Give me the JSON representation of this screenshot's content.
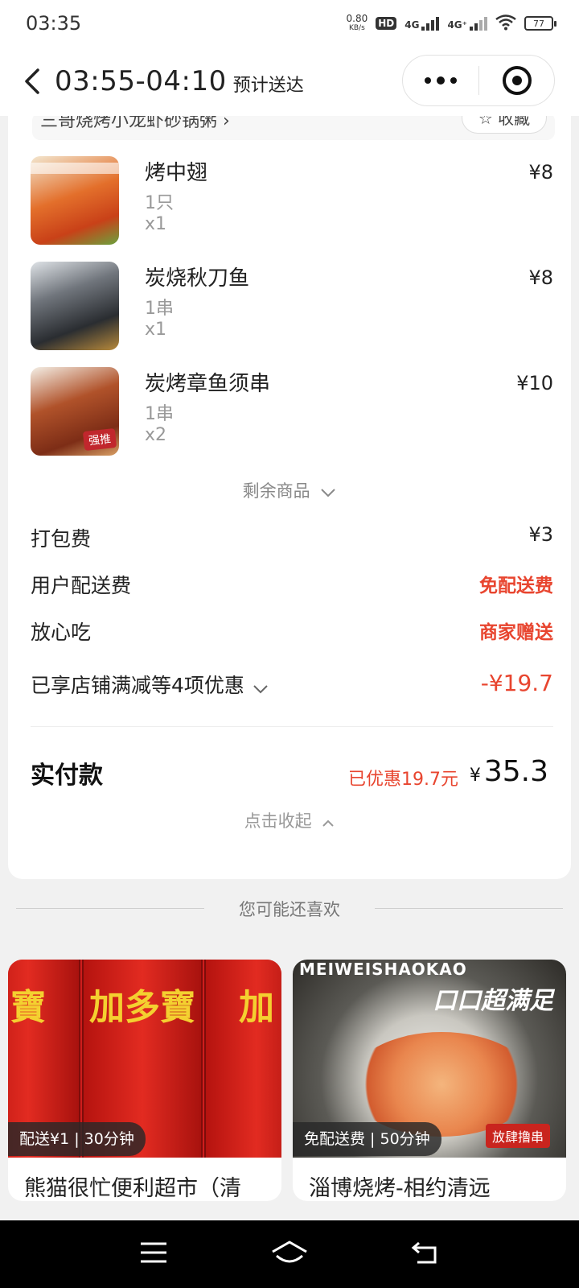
{
  "status_bar": {
    "time": "03:35",
    "net_speed_value": "0.80",
    "net_speed_unit": "KB/s",
    "hd_label": "HD",
    "sim1": "1",
    "sim2": "2",
    "net1": "4G",
    "net2": "4G⁺",
    "battery": "77"
  },
  "nav": {
    "delivery_time": "03:55-04:10",
    "delivery_label": "预计送达"
  },
  "store_row": {
    "name_partial": "三哥烧烤小龙虾砂锅粥 ›",
    "favorite_label": "☆ 收藏"
  },
  "items": [
    {
      "name": "烤中翅",
      "spec": "1只",
      "qty": "x1",
      "price": "¥8"
    },
    {
      "name": "炭烧秋刀鱼",
      "spec": "1串",
      "qty": "x1",
      "price": "¥8"
    },
    {
      "name": "炭烤章鱼须串",
      "spec": "1串",
      "qty": "x2",
      "price": "¥10",
      "thumb_tag": "强推"
    }
  ],
  "more_goods_label": "剩余商品",
  "fees": {
    "packing_label": "打包费",
    "packing_value": "¥3",
    "delivery_label": "用户配送费",
    "delivery_value": "免配送费",
    "safe_label": "放心吃",
    "safe_value": "商家赠送",
    "discount_label": "已享店铺满减等4项优惠",
    "discount_value": "-¥19.7"
  },
  "total": {
    "label": "实付款",
    "saved": "已优惠19.7元",
    "currency": "¥",
    "amount": "35.3"
  },
  "collapse_label": "点击收起",
  "recommend": {
    "title": "您可能还喜欢",
    "cards": [
      {
        "name": "熊猫很忙便利超市（清",
        "badge": "配送¥1 | 30分钟",
        "brand_text": "加多寶"
      },
      {
        "name": "淄博烧烤-相约清远",
        "badge": "免配送费 | 50分钟",
        "brand_text": "MEIWEISHAOKAO",
        "slogan": "口口超满足",
        "stamp": "放肆撸串"
      }
    ]
  },
  "colors": {
    "accent_red": "#e8452f",
    "background": "#f1f1f1",
    "card": "#ffffff"
  }
}
